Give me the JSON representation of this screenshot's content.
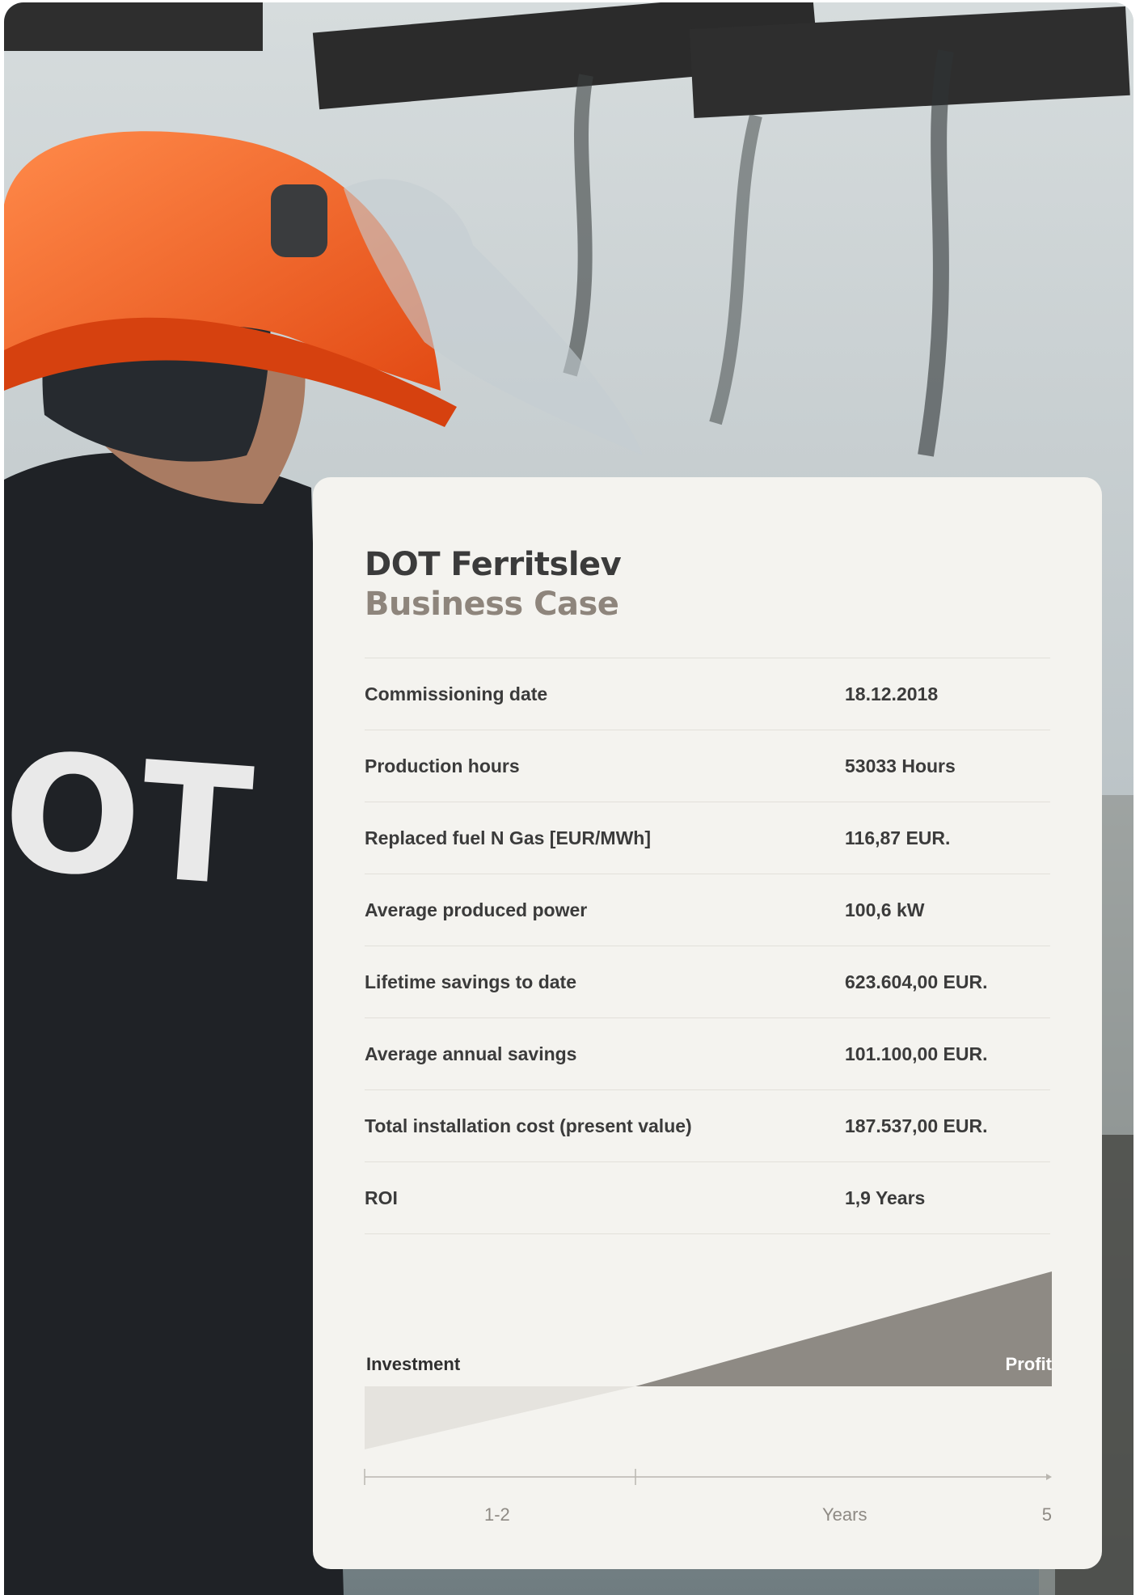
{
  "card": {
    "title": "DOT Ferritslev",
    "subtitle": "Business Case"
  },
  "rows": [
    {
      "label": "Commissioning date",
      "value": "18.12.2018"
    },
    {
      "label": "Production hours",
      "value": "53033 Hours"
    },
    {
      "label": "Replaced fuel N Gas [EUR/MWh]",
      "value": "116,87 EUR."
    },
    {
      "label": "Average produced power",
      "value": "100,6 kW"
    },
    {
      "label": "Lifetime savings to date",
      "value": "623.604,00 EUR."
    },
    {
      "label": "Average annual savings",
      "value": "101.100,00 EUR."
    },
    {
      "label": "Total installation cost (present value)",
      "value": "187.537,00 EUR."
    },
    {
      "label": "ROI",
      "value": "1,9 Years"
    }
  ],
  "photo": {
    "jacket_text": "OT"
  },
  "chart_data": {
    "type": "area",
    "labels": {
      "investment": "Investment",
      "profit": "Profit"
    },
    "x_ticks": [
      "1-2",
      "Years",
      "5"
    ],
    "colors": {
      "investment_fill": "#e5e3de",
      "profit_fill": "#8e8a84",
      "axis": "#b9b6b0"
    }
  }
}
